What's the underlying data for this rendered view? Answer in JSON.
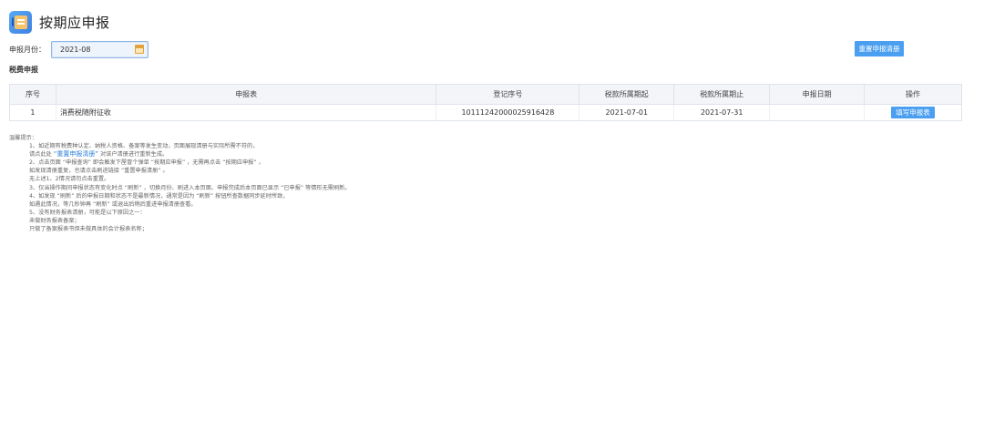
{
  "header": {
    "title": "按期应申报"
  },
  "period": {
    "label": "申报月份：",
    "value": "2021-08"
  },
  "toolbar": {
    "reset_list_label": "重置申报清册"
  },
  "section": {
    "title": "税费申报"
  },
  "table": {
    "headers": [
      "序号",
      "申报表",
      "登记序号",
      "税款所属期起",
      "税款所属期止",
      "申报日期",
      "操作"
    ],
    "rows": [
      {
        "no": "1",
        "form": "消费税随附征收",
        "reg_no": "10111242000025916428",
        "start": "2021-07-01",
        "end": "2021-07-31",
        "date": "",
        "action": "填写申报表"
      }
    ]
  },
  "tips": {
    "title": "温馨提示：",
    "line1": "1、如近期有税费种认定、纳税人资格、备案等发生变动，页面展现清册与实际所需不符的，",
    "line2a": "请点此处",
    "line2_link": "“重置申报清册”",
    "line2b": "对该户清册进行重新生成。",
    "line3": "2、点击页面 “申报查询” 即会触发下屋冒个弹单 “按期应申报” ，无需再点击 “按期应申报” ，",
    "line4": "如发现清册重复，也请点击刷进链接 “重置申报清册” 。",
    "line5": "无上述1、2情况请勿点击重置。",
    "line6": "3、仅当操作期间申报状态有变化时点 “刷新” ，切换月份、刷进入本页面、申报完成后本页面已显示 “已申报” 等情形无需刷新。",
    "line7": "4、如发现 “刷新” 后的申报日期和状态不是最新情况，通常是因为 “刷新” 按钮所查数据同步延时所致，",
    "line8": "如遇此情况，等几秒钟再 “刷新” 或退出后稍后重进申报清册查看。",
    "line9": "5、没有财务报表清册，可能是以下原因之一：",
    "line10": "未做财务报表备案；",
    "line11": "只做了备案报表书但未做具体的会计报表名称；"
  }
}
